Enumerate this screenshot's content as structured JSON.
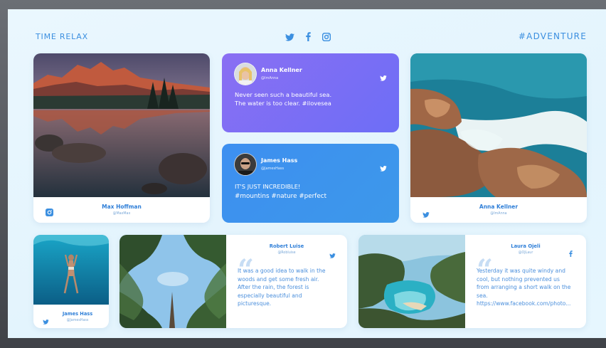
{
  "header": {
    "brand": "TIME RELAX",
    "hashtag": "#ADVENTURE",
    "social_icons": [
      "twitter-icon",
      "facebook-icon",
      "instagram-icon"
    ]
  },
  "colors": {
    "accent": "#3b8fe0",
    "purple_card": "#7b6ff5",
    "blue_card": "#3f93ee",
    "background": "#e6f6fe"
  },
  "cards": {
    "max": {
      "name": "Max Hoffman",
      "handle": "@MaxMax",
      "icon": "instagram-icon"
    },
    "anna_tweet": {
      "name": "Anna Kellner",
      "handle": "@ImAnna",
      "line1": "Never seen such a beautiful sea.",
      "line2": "The water is too clear. #ilovesea",
      "icon": "twitter-icon"
    },
    "james_tweet": {
      "name": "James Hass",
      "handle": "@JamesHass",
      "line1": "IT'S JUST INCREDIBLE!",
      "line2": "#mountins #nature #perfect",
      "icon": "twitter-icon"
    },
    "anna_photo": {
      "name": "Anna Kellner",
      "handle": "@ImAnna",
      "icon": "twitter-icon"
    },
    "james_photo": {
      "name": "James Hass",
      "handle": "@JamesHass",
      "icon": "twitter-icon"
    },
    "robert": {
      "name": "Robert Luise",
      "handle": "@Robluise",
      "lines": [
        "It was a good idea to walk in the",
        "woods and get some fresh air.",
        "After the rain, the forest is",
        "especially beautiful and",
        "picturesque."
      ],
      "icon": "twitter-icon"
    },
    "laura": {
      "name": "Laura Ojeli",
      "handle": "@OJLaur",
      "lines": [
        "Yesterday it was quite windy and",
        "cool, but nothing prevented us",
        "from arranging a short walk on the",
        "sea.",
        "https://www.facebook.com/photo..."
      ],
      "icon": "facebook-icon"
    }
  }
}
